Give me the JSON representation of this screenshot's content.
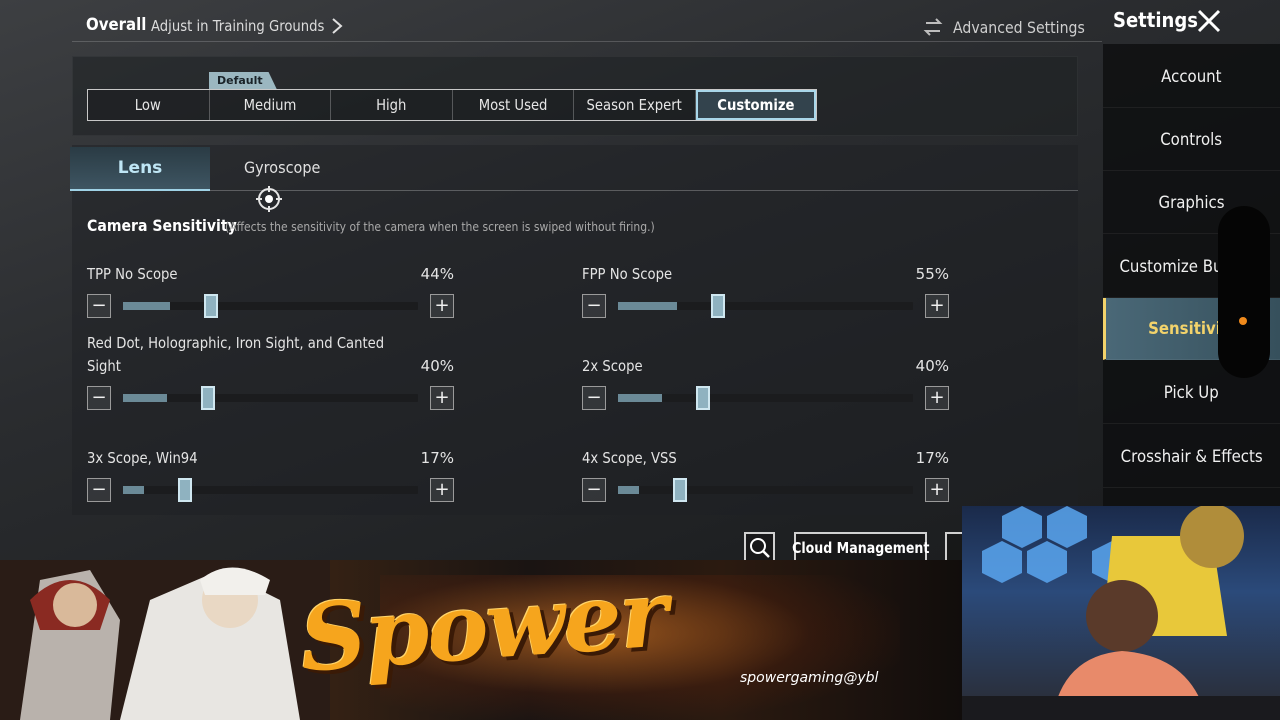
{
  "header": {
    "overall": "Overall",
    "adjust": "Adjust in Training Grounds",
    "advanced": "Advanced Settings",
    "settings_title": "Settings"
  },
  "presets": {
    "default_tag": "Default",
    "items": [
      "Low",
      "Medium",
      "High",
      "Most Used",
      "Season Expert",
      "Customize"
    ],
    "active": "Customize"
  },
  "tabs": {
    "lens": "Lens",
    "gyroscope": "Gyroscope"
  },
  "camera": {
    "title": "Camera Sensitivity",
    "desc": "(Affects the sensitivity of the camera when the screen is swiped without firing.)",
    "sliders": [
      {
        "label": "TPP No Scope",
        "value": "44%",
        "level": 0.16
      },
      {
        "label": "FPP No Scope",
        "value": "55%",
        "level": 0.2
      },
      {
        "label": "Red Dot, Holographic, Iron Sight, and Canted",
        "label2": "Sight",
        "value": "40%",
        "level": 0.15
      },
      {
        "label": "2x Scope",
        "value": "40%",
        "level": 0.15
      },
      {
        "label": "3x Scope, Win94",
        "value": "17%",
        "level": 0.07
      },
      {
        "label": "4x Scope, VSS",
        "value": "17%",
        "level": 0.07
      }
    ]
  },
  "sidebar": {
    "items": [
      "Account",
      "Controls",
      "Graphics",
      "Customize Butto",
      "Sensitivity",
      "Pick Up",
      "Crosshair & Effects"
    ],
    "active": "Sensitivity"
  },
  "bottom": {
    "cloud": "Cloud Management"
  },
  "overlay": {
    "brand": "Spower",
    "handle": "spowergaming@ybl"
  },
  "colors": {
    "accent": "#a9d7ea",
    "active_sidebar_text": "#f3d36b",
    "slider_thumb": "#8fb2c0"
  }
}
